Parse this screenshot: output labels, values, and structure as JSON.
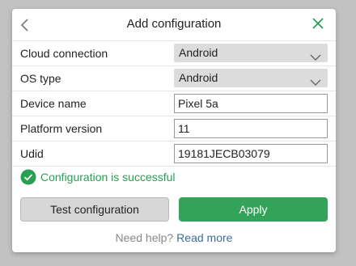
{
  "dialog": {
    "title": "Add configuration"
  },
  "fields": {
    "cloud_connection": {
      "label": "Cloud connection",
      "value": "Android"
    },
    "os_type": {
      "label": "OS type",
      "value": "Android"
    },
    "device_name": {
      "label": "Device name",
      "value": "Pixel 5a"
    },
    "platform_version": {
      "label": "Platform version",
      "value": "11"
    },
    "udid": {
      "label": "Udid",
      "value": "19181JECB03079"
    }
  },
  "status": {
    "text": "Configuration is successful"
  },
  "buttons": {
    "test": "Test configuration",
    "apply": "Apply"
  },
  "help": {
    "text": "Need help?",
    "link": "Read more"
  },
  "colors": {
    "success": "#27a052",
    "apply_button": "#33a35a",
    "link": "#3a6f9e"
  },
  "icons": {
    "back": "chevron-left-icon",
    "close": "close-icon",
    "dropdown": "chevron-down-icon",
    "status": "check-circle-icon"
  }
}
